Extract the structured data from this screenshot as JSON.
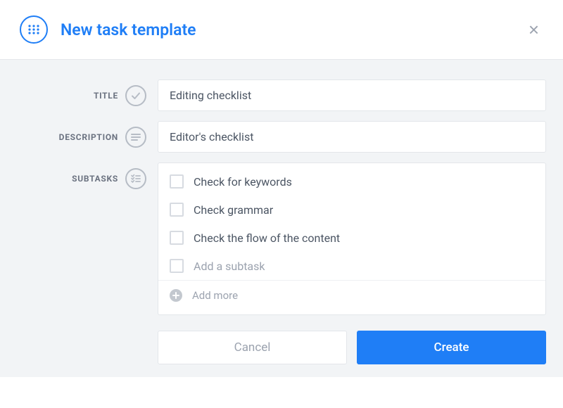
{
  "header": {
    "title": "New task template"
  },
  "fields": {
    "title": {
      "label": "TITLE",
      "value": "Editing checklist"
    },
    "description": {
      "label": "DESCRIPTION",
      "value": "Editor's checklist"
    },
    "subtasks": {
      "label": "SUBTASKS",
      "items": [
        "Check for keywords",
        "Check grammar",
        "Check the flow of the content"
      ],
      "placeholder": "Add a subtask",
      "addMore": "Add more"
    }
  },
  "buttons": {
    "cancel": "Cancel",
    "create": "Create"
  },
  "colors": {
    "accent": "#1f7ef6"
  }
}
